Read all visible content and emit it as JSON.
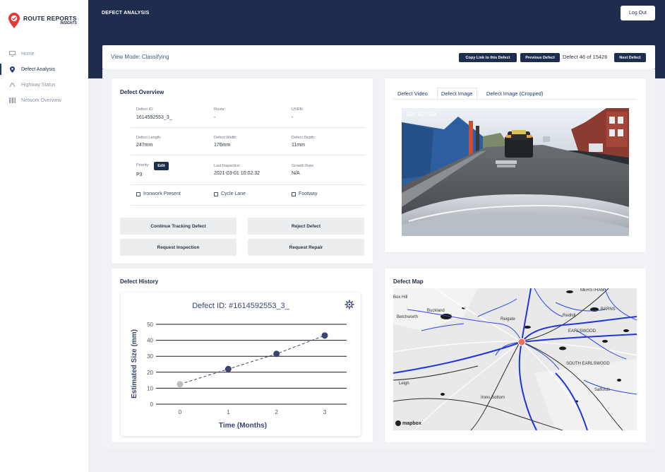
{
  "app": {
    "logo_title": "ROUTE REPORTS",
    "logo_sub": "INSIGHTS",
    "brand_color": "#e53935",
    "nav_color": "#1e2d4f"
  },
  "sidebar": {
    "items": [
      {
        "label": "Home",
        "icon": "monitor-icon",
        "active": false
      },
      {
        "label": "Defect Analysis",
        "icon": "location-pin-icon",
        "active": true
      },
      {
        "label": "Highway Status",
        "icon": "road-icon",
        "active": false
      },
      {
        "label": "Network Overview",
        "icon": "barcode-icon",
        "active": false
      }
    ]
  },
  "header": {
    "title": "DEFECT ANALYSIS",
    "logout_label": "Log Out"
  },
  "toolbar": {
    "mode_text": "View Mode: Classifying",
    "copy_link_label": "Copy Link to this Defect",
    "previous_label": "Previous Defect",
    "counter_text": "Defect 46 of 15426",
    "next_label": "Next Defect"
  },
  "overview": {
    "title": "Defect Overview",
    "defect_id_label": "Defect ID:",
    "defect_id": "1614592553_3_",
    "route_label": "Route:",
    "route": "-",
    "usrn_label": "USRN:",
    "usrn": "-",
    "length_label": "Defect Length:",
    "length": "247mm",
    "width_label": "Defect Width:",
    "width": "176mm",
    "depth_label": "Defect Depth:",
    "depth": "11mm",
    "priority_label": "Priority:",
    "priority": "P3",
    "edit_label": "Edit",
    "last_inspected_label": "Last Inspected:",
    "last_inspected": "2021-03-01 10:02:32",
    "growth_label": "Growth Rate:",
    "growth": "N/A",
    "checkbox_ironwork": "Ironwork Present",
    "checkbox_cycle": "Cycle Lane",
    "checkbox_footway": "Footway",
    "btn_continue": "Continue Tracking Defect",
    "btn_reject": "Reject Defect",
    "btn_inspection": "Request Inspection",
    "btn_repair": "Request Repair"
  },
  "media": {
    "tabs": [
      {
        "label": "Defect Video",
        "active": false
      },
      {
        "label": "Defect Image",
        "active": true
      },
      {
        "label": "Defect Image (Cropped)",
        "active": false
      }
    ],
    "timestamp": "10:02:29"
  },
  "history": {
    "title": "Defect History",
    "settings_icon": "gear-icon"
  },
  "chart_data": {
    "type": "line",
    "title": "Defect ID: #1614592553_3_",
    "xlabel": "Time (Months)",
    "ylabel": "Estimated Size (mm)",
    "x": [
      0,
      1,
      2,
      3
    ],
    "values": [
      12.5,
      22,
      31.5,
      43
    ],
    "ylim": [
      0,
      50
    ],
    "yticks": [
      0,
      10,
      20,
      30,
      40,
      50
    ],
    "xticks": [
      0,
      1,
      2,
      3
    ],
    "grid": true,
    "line_style": "dashed",
    "point_colors": [
      "#bdbdbd",
      "#3b4470",
      "#3b4470",
      "#3b4470"
    ]
  },
  "map": {
    "title": "Defect Map",
    "attribution": "mapbox",
    "labels": [
      "Box Hill",
      "Buckland",
      "Betchworth",
      "Reigate",
      "Redhill",
      "EARLSWOOD",
      "SOUTH EARLSWOOD",
      "Salfords",
      "Leigh",
      "Irons Bottom",
      "MERSTHAM",
      "BARNS"
    ]
  }
}
